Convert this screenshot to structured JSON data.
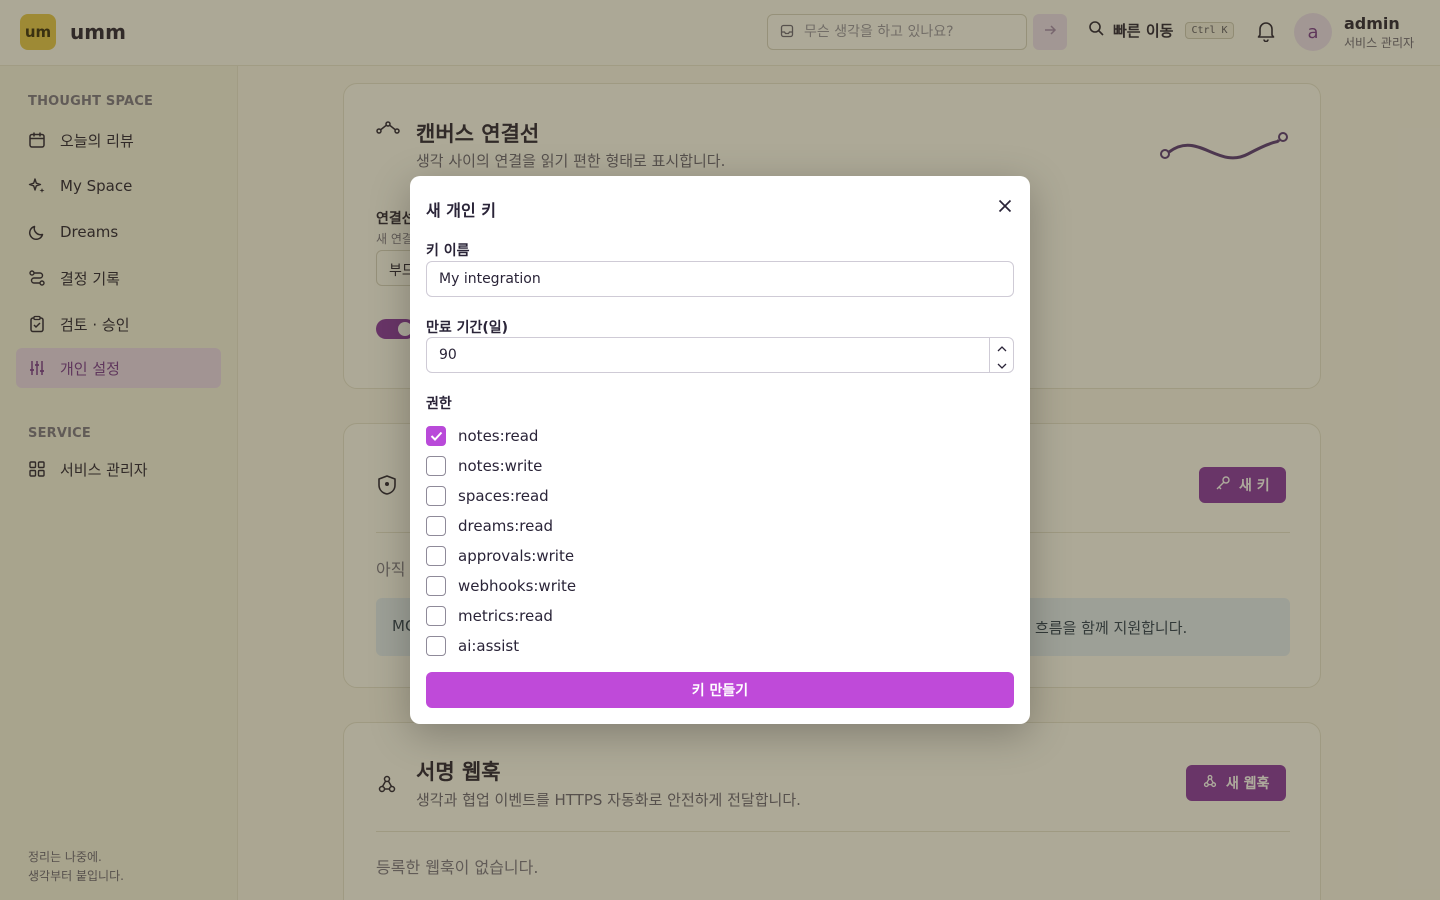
{
  "header": {
    "logo_text": "um",
    "app_name": "umm",
    "quick_thought_placeholder": "무슨 생각을 하고 있나요?",
    "jump_label": "빠른 이동",
    "jump_shortcut": "Ctrl K",
    "avatar_letter": "a",
    "user_name": "admin",
    "user_role": "서비스 관리자"
  },
  "sidebar": {
    "section_thought": "THOUGHT SPACE",
    "items": [
      {
        "label": "오늘의 리뷰",
        "icon": "calendar-icon"
      },
      {
        "label": "My Space",
        "icon": "sparkles-icon"
      },
      {
        "label": "Dreams",
        "icon": "moon-icon"
      },
      {
        "label": "결정 기록",
        "icon": "route-icon"
      },
      {
        "label": "검토 · 승인",
        "icon": "clipboard-check-icon"
      },
      {
        "label": "개인 설정",
        "icon": "sliders-icon",
        "active": true
      }
    ],
    "section_service": "SERVICE",
    "service_items": [
      {
        "label": "서비스 관리자",
        "icon": "grid-icon"
      }
    ],
    "footer_line1": "정리는 나중에.",
    "footer_line2": "생각부터 붙입니다."
  },
  "main": {
    "canvas_card": {
      "title": "캔버스 연결선",
      "subtitle": "생각 사이의 연결을 읽기 편한 형태로 표시합니다.",
      "field_label": "연결선",
      "field_hint": "새 연결",
      "select_value": "부드"
    },
    "keys_card": {
      "new_key_button": "새 키",
      "empty_text": "아직",
      "info_left": "MC",
      "info_right": "흐름을 함께 지원합니다."
    },
    "webhook_card": {
      "title": "서명 웹훅",
      "subtitle": "생각과 협업 이벤트를 HTTPS 자동화로 안전하게 전달합니다.",
      "new_webhook_button": "새 웹훅",
      "empty_text": "등록한 웹훅이 없습니다."
    }
  },
  "modal": {
    "title": "새 개인 키",
    "name_label": "키 이름",
    "name_value": "My integration",
    "expiry_label": "만료 기간(일)",
    "expiry_value": "90",
    "permissions_label": "권한",
    "permissions": [
      {
        "label": "notes:read",
        "checked": true
      },
      {
        "label": "notes:write",
        "checked": false
      },
      {
        "label": "spaces:read",
        "checked": false
      },
      {
        "label": "dreams:read",
        "checked": false
      },
      {
        "label": "approvals:write",
        "checked": false
      },
      {
        "label": "webhooks:write",
        "checked": false
      },
      {
        "label": "metrics:read",
        "checked": false
      },
      {
        "label": "ai:assist",
        "checked": false
      }
    ],
    "submit_label": "키 만들기"
  },
  "colors": {
    "accent": "#bf4ad9",
    "accent_dark": "#8a36a6",
    "logo_yellow": "#e5c84e"
  }
}
